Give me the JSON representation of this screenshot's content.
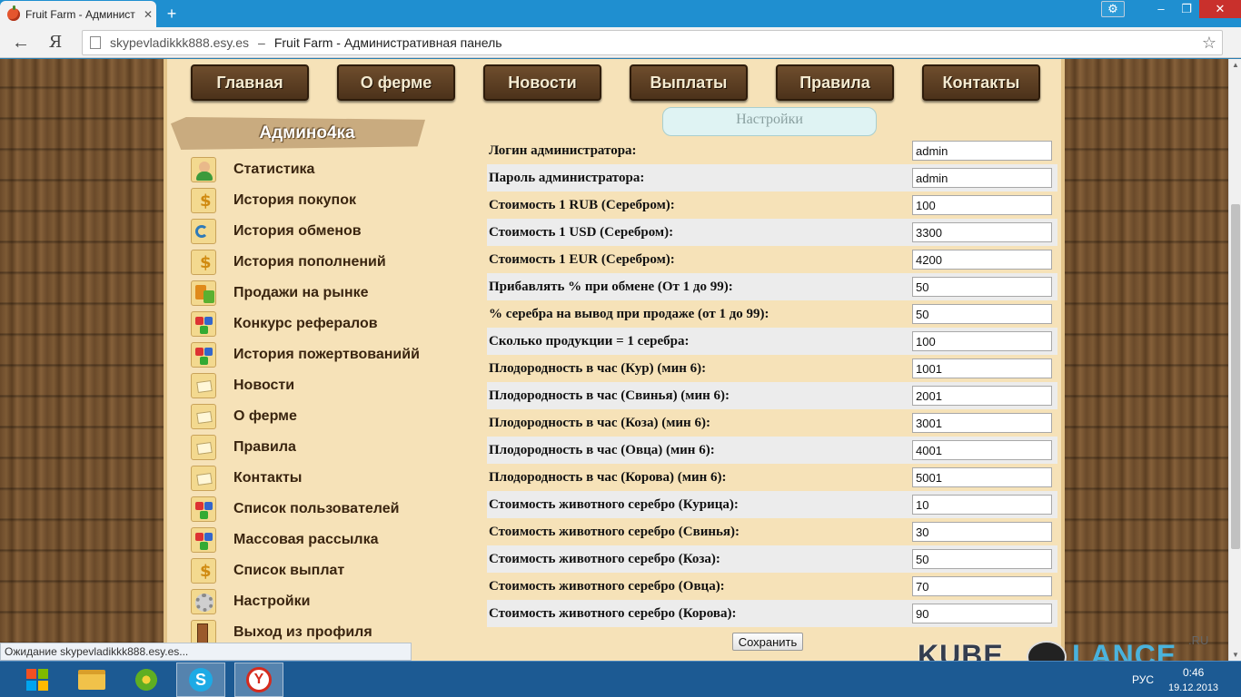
{
  "browser": {
    "tab_title": "Fruit Farm - Админист",
    "tab_close": "✕",
    "new_tab": "+",
    "back": "←",
    "yandex_logo": "Я",
    "url_domain": "skypevladikkk888.esy.es",
    "url_separator": "–",
    "page_title": "Fruit Farm - Административная панель",
    "star": "☆",
    "window_buttons": {
      "minimize": "–",
      "maximize": "❐",
      "close": "✕",
      "settings": "⚙"
    },
    "status_text": "Ожидание skypevladikkk888.esy.es..."
  },
  "nav": {
    "items": [
      "Главная",
      "О ферме",
      "Новости",
      "Выплаты",
      "Правила",
      "Контакты"
    ]
  },
  "sidebar": {
    "title": "Админо4ка",
    "items": [
      {
        "label": "Статистика",
        "icon": "user-icon"
      },
      {
        "label": "История покупок",
        "icon": "money-icon"
      },
      {
        "label": "История обменов",
        "icon": "exchange-icon"
      },
      {
        "label": "История пополнений",
        "icon": "money-icon"
      },
      {
        "label": "Продажи на рынке",
        "icon": "market-icon"
      },
      {
        "label": "Конкурс рефералов",
        "icon": "puzzle-icon"
      },
      {
        "label": "История пожертвованийй",
        "icon": "puzzle-icon"
      },
      {
        "label": "Новости",
        "icon": "document-icon"
      },
      {
        "label": "О ферме",
        "icon": "document-icon"
      },
      {
        "label": "Правила",
        "icon": "document-icon"
      },
      {
        "label": "Контакты",
        "icon": "document-icon"
      },
      {
        "label": "Список пользователей",
        "icon": "puzzle-icon"
      },
      {
        "label": "Массовая рассылка",
        "icon": "puzzle-icon"
      },
      {
        "label": "Список выплат",
        "icon": "money-icon"
      },
      {
        "label": "Настройки",
        "icon": "gear-icon"
      },
      {
        "label": "Выход из профиля",
        "icon": "exit-door-icon"
      }
    ]
  },
  "settings": {
    "tab_label": "Настройки",
    "save_label": "Сохранить",
    "rows": [
      {
        "label": "Логин администратора:",
        "value": "admin"
      },
      {
        "label": "Пароль администратора:",
        "value": "admin"
      },
      {
        "label": "Стоимость 1 RUB (Серебром):",
        "value": "100"
      },
      {
        "label": "Стоимость 1 USD (Серебром):",
        "value": "3300"
      },
      {
        "label": "Стоимость 1 EUR (Серебром):",
        "value": "4200"
      },
      {
        "label": "Прибавлять % при обмене (От 1 до 99):",
        "value": "50"
      },
      {
        "label": "% серебра на вывод при продаже (от 1 до 99):",
        "value": "50"
      },
      {
        "label": "Сколько продукции = 1 серебра:",
        "value": "100"
      },
      {
        "label": "Плодородность в час (Кур) (мин 6):",
        "value": "1001"
      },
      {
        "label": "Плодородность в час (Свинья) (мин 6):",
        "value": "2001"
      },
      {
        "label": "Плодородность в час (Коза) (мин 6):",
        "value": "3001"
      },
      {
        "label": "Плодородность в час (Овца) (мин 6):",
        "value": "4001"
      },
      {
        "label": "Плодородность в час (Корова) (мин 6):",
        "value": "5001"
      },
      {
        "label": "Стоимость животного серебро (Курица):",
        "value": "10"
      },
      {
        "label": "Стоимость животного серебро (Свинья):",
        "value": "30"
      },
      {
        "label": "Стоимость животного серебро (Коза):",
        "value": "50"
      },
      {
        "label": "Стоимость животного серебро (Овца):",
        "value": "70"
      },
      {
        "label": "Стоимость животного серебро (Корова):",
        "value": "90"
      }
    ]
  },
  "watermark": {
    "left": "KUBE",
    "right": "LANCE",
    "suffix": ".RU"
  },
  "taskbar": {
    "lang": "РУС",
    "time": "0:46",
    "date": "19.12.2013"
  },
  "colors": {
    "chrome_blue": "#1f8fd0",
    "page_bg": "#f6e2b8",
    "nav_button": "#5a3c20",
    "taskbar": "#1c5a93"
  }
}
